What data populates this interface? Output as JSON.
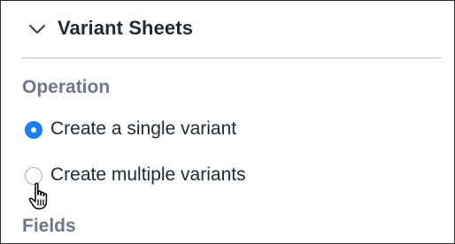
{
  "panel": {
    "title": "Variant Sheets",
    "collapse_icon": "chevron-down-icon"
  },
  "operation": {
    "label": "Operation",
    "options": [
      {
        "label": "Create a single variant",
        "selected": true
      },
      {
        "label": "Create multiple variants",
        "selected": false
      }
    ]
  },
  "fields": {
    "label": "Fields"
  },
  "colors": {
    "accent": "#1a7ff2",
    "title_text": "#1e2a36",
    "section_label": "#6a7889",
    "divider": "#b9c3cd"
  },
  "cursor": {
    "icon": "hand-pointer-icon"
  }
}
